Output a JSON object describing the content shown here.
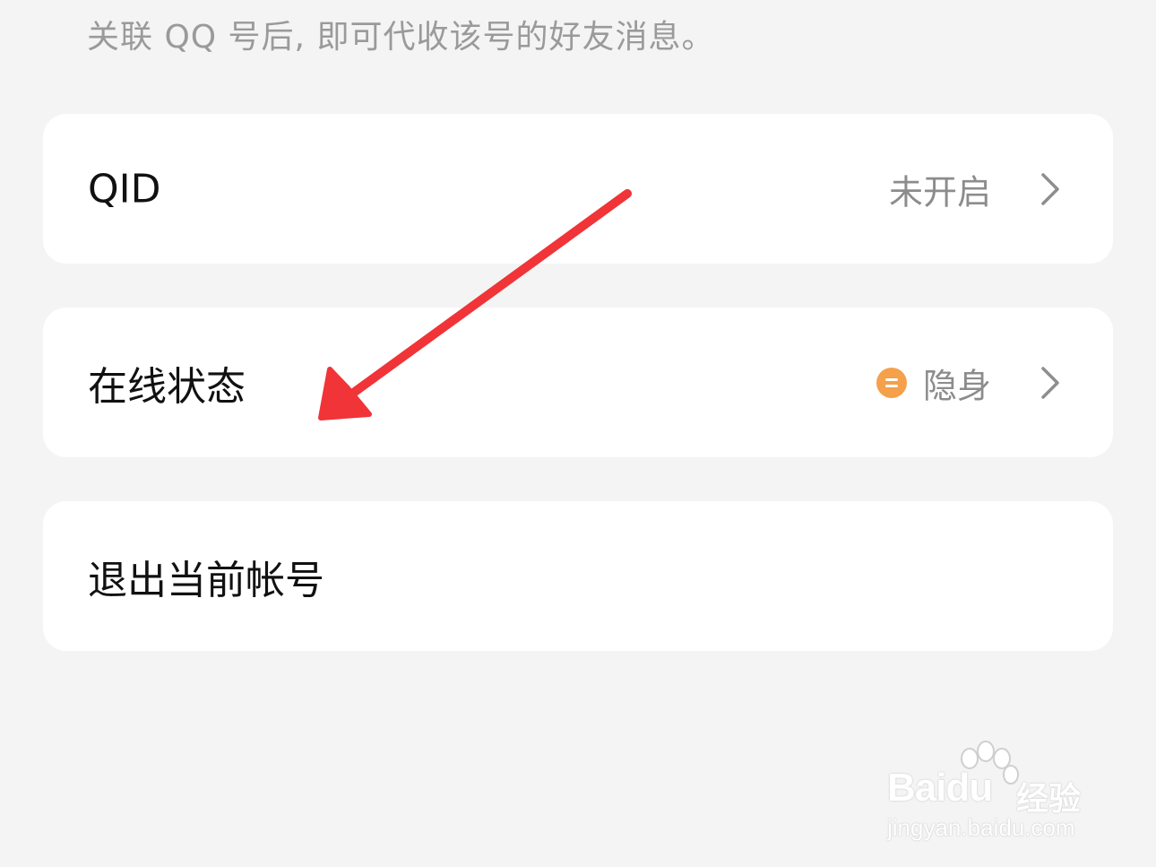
{
  "hint_text": "关联 QQ 号后, 即可代收该号的好友消息。",
  "items": [
    {
      "label": "QID",
      "value": "未开启"
    },
    {
      "label": "在线状态",
      "value": "隐身",
      "status_icon": "invisible-status-icon",
      "status_color": "#f5a04a"
    },
    {
      "label": "退出当前帐号"
    }
  ],
  "annotation": {
    "type": "arrow",
    "color": "#f03437"
  },
  "watermark": {
    "brand": "Bai",
    "brand_mid": "du",
    "suffix": "经验",
    "url": "jingyan.baidu.com"
  }
}
